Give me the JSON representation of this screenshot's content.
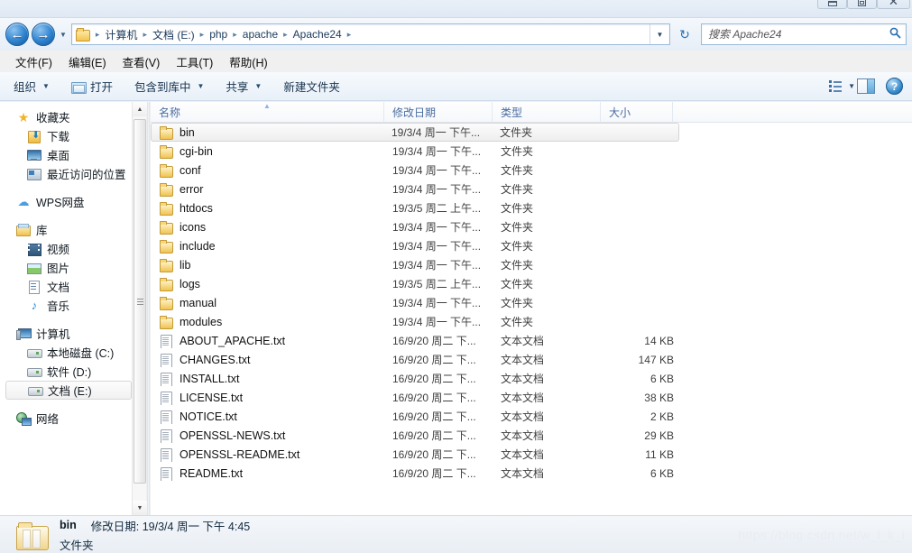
{
  "window": {
    "controls": {
      "minimize": "minimize-label",
      "maximize": "maximize-label",
      "close": "✕"
    }
  },
  "nav": {
    "back_label": "←",
    "forward_label": "→",
    "history_caret": "▼",
    "breadcrumb": [
      "计算机",
      "文档 (E:)",
      "php",
      "apache",
      "Apache24"
    ],
    "breadcrumb_sep": "▸",
    "crumb_dropdown": "▼",
    "refresh_label": "↻"
  },
  "search": {
    "placeholder": "搜索 Apache24",
    "icon": "search-icon",
    "value": ""
  },
  "menubar": [
    "文件(F)",
    "编辑(E)",
    "查看(V)",
    "工具(T)",
    "帮助(H)"
  ],
  "commandbar": {
    "organize": "组织",
    "open": "打开",
    "include_in_library": "包含到库中",
    "share": "共享",
    "new_folder": "新建文件夹",
    "caret": "▼",
    "help_glyph": "?"
  },
  "sidebar": {
    "groups": [
      {
        "header": {
          "label": "收藏夹",
          "icon": "star-icon"
        },
        "items": [
          {
            "label": "下载",
            "icon": "download-folder-icon"
          },
          {
            "label": "桌面",
            "icon": "desktop-icon"
          },
          {
            "label": "最近访问的位置",
            "icon": "recent-places-icon"
          }
        ]
      },
      {
        "header": {
          "label": "WPS网盘",
          "icon": "cloud-icon"
        },
        "items": []
      },
      {
        "header": {
          "label": "库",
          "icon": "library-icon"
        },
        "items": [
          {
            "label": "视频",
            "icon": "video-icon"
          },
          {
            "label": "图片",
            "icon": "picture-icon"
          },
          {
            "label": "文档",
            "icon": "document-icon"
          },
          {
            "label": "音乐",
            "icon": "music-icon"
          }
        ]
      },
      {
        "header": {
          "label": "计算机",
          "icon": "computer-icon"
        },
        "items": [
          {
            "label": "本地磁盘 (C:)",
            "icon": "drive-icon"
          },
          {
            "label": "软件 (D:)",
            "icon": "drive-icon"
          },
          {
            "label": "文档 (E:)",
            "icon": "drive-icon",
            "selected": true
          }
        ]
      },
      {
        "header": {
          "label": "网络",
          "icon": "network-icon"
        },
        "items": []
      }
    ],
    "scroll": {
      "up": "▲",
      "down": "▼"
    }
  },
  "filelist": {
    "columns": [
      {
        "label": "名称",
        "sort": "asc",
        "sort_glyph": "▲"
      },
      {
        "label": "修改日期"
      },
      {
        "label": "类型"
      },
      {
        "label": "大小"
      }
    ],
    "rows": [
      {
        "name": "bin",
        "icon": "folder-icon",
        "date": "19/3/4 周一 下午...",
        "type": "文件夹",
        "size": "",
        "selected": true
      },
      {
        "name": "cgi-bin",
        "icon": "folder-icon",
        "date": "19/3/4 周一 下午...",
        "type": "文件夹",
        "size": ""
      },
      {
        "name": "conf",
        "icon": "folder-icon",
        "date": "19/3/4 周一 下午...",
        "type": "文件夹",
        "size": ""
      },
      {
        "name": "error",
        "icon": "folder-icon",
        "date": "19/3/4 周一 下午...",
        "type": "文件夹",
        "size": ""
      },
      {
        "name": "htdocs",
        "icon": "folder-icon",
        "date": "19/3/5 周二 上午...",
        "type": "文件夹",
        "size": ""
      },
      {
        "name": "icons",
        "icon": "folder-icon",
        "date": "19/3/4 周一 下午...",
        "type": "文件夹",
        "size": ""
      },
      {
        "name": "include",
        "icon": "folder-icon",
        "date": "19/3/4 周一 下午...",
        "type": "文件夹",
        "size": ""
      },
      {
        "name": "lib",
        "icon": "folder-icon",
        "date": "19/3/4 周一 下午...",
        "type": "文件夹",
        "size": ""
      },
      {
        "name": "logs",
        "icon": "folder-icon",
        "date": "19/3/5 周二 上午...",
        "type": "文件夹",
        "size": ""
      },
      {
        "name": "manual",
        "icon": "folder-icon",
        "date": "19/3/4 周一 下午...",
        "type": "文件夹",
        "size": ""
      },
      {
        "name": "modules",
        "icon": "folder-icon",
        "date": "19/3/4 周一 下午...",
        "type": "文件夹",
        "size": ""
      },
      {
        "name": "ABOUT_APACHE.txt",
        "icon": "text-file-icon",
        "date": "16/9/20 周二 下...",
        "type": "文本文档",
        "size": "14 KB"
      },
      {
        "name": "CHANGES.txt",
        "icon": "text-file-icon",
        "date": "16/9/20 周二 下...",
        "type": "文本文档",
        "size": "147 KB"
      },
      {
        "name": "INSTALL.txt",
        "icon": "text-file-icon",
        "date": "16/9/20 周二 下...",
        "type": "文本文档",
        "size": "6 KB"
      },
      {
        "name": "LICENSE.txt",
        "icon": "text-file-icon",
        "date": "16/9/20 周二 下...",
        "type": "文本文档",
        "size": "38 KB"
      },
      {
        "name": "NOTICE.txt",
        "icon": "text-file-icon",
        "date": "16/9/20 周二 下...",
        "type": "文本文档",
        "size": "2 KB"
      },
      {
        "name": "OPENSSL-NEWS.txt",
        "icon": "text-file-icon",
        "date": "16/9/20 周二 下...",
        "type": "文本文档",
        "size": "29 KB"
      },
      {
        "name": "OPENSSL-README.txt",
        "icon": "text-file-icon",
        "date": "16/9/20 周二 下...",
        "type": "文本文档",
        "size": "11 KB"
      },
      {
        "name": "README.txt",
        "icon": "text-file-icon",
        "date": "16/9/20 周二 下...",
        "type": "文本文档",
        "size": "6 KB"
      }
    ]
  },
  "statusbar": {
    "item_name": "bin",
    "modified_label": "修改日期:",
    "modified_value": "19/3/4 周一 下午 4:45",
    "item_type": "文件夹"
  },
  "watermark": "https://blog.csdn.net/w_l_k_i",
  "colors": {
    "accent_blue": "#2d82d0",
    "header_text": "#4a6da0",
    "folder_yellow": "#f0c34f",
    "window_bg": "#f0f0f0"
  }
}
